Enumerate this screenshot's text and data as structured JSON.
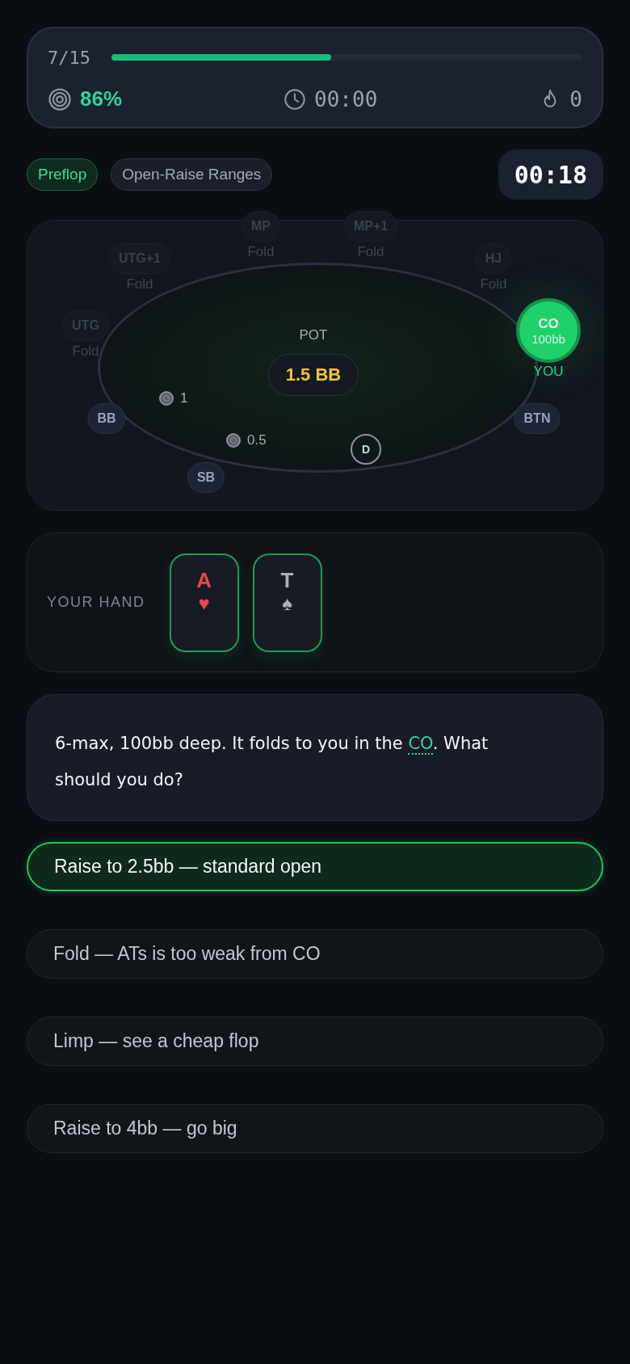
{
  "progress": {
    "count": "7/15",
    "level": 0.467
  },
  "stats": {
    "accuracy": "86%",
    "time": "00:00",
    "streak": "0"
  },
  "tags": [
    {
      "label": "Preflop",
      "kind": "street"
    },
    {
      "label": "Open-Raise Ranges",
      "kind": "topic"
    }
  ],
  "timer": "00:18",
  "table": {
    "seats": [
      {
        "position": "MP",
        "action": "Fold",
        "kind": "folded"
      },
      {
        "position": "MP+1",
        "action": "Fold",
        "kind": "folded"
      },
      {
        "position": "UTG+1",
        "action": "Fold",
        "kind": "folded"
      },
      {
        "position": "HJ",
        "action": "Fold",
        "kind": "folded"
      },
      {
        "position": "UTG",
        "action": "Fold",
        "kind": "folded"
      },
      {
        "position": "CO",
        "stack": "100bb",
        "tag": "YOU",
        "kind": "hero"
      },
      {
        "position": "BB",
        "kind": "waiting"
      },
      {
        "position": "BTN",
        "kind": "waiting"
      },
      {
        "position": "SB",
        "kind": "waiting"
      }
    ],
    "pot_label": "POT",
    "pot": "1.5 BB",
    "bets": [
      {
        "amount": "1"
      },
      {
        "amount": "0.5"
      }
    ],
    "dealer": "D"
  },
  "hand": {
    "label": "YOUR HAND",
    "cards": [
      {
        "rank": "A",
        "suit": "♥",
        "color": "#e5484d"
      },
      {
        "rank": "T",
        "suit": "♠",
        "color": "#a9b0bc"
      }
    ]
  },
  "question": {
    "before": "6-max, 100bb deep. It folds to you in the ",
    "term": "CO",
    "after": ". What should you do?"
  },
  "options": [
    {
      "label": "Raise to 2.5bb — standard open",
      "selected": true
    },
    {
      "label": "Fold — ATs is too weak from CO",
      "selected": false
    },
    {
      "label": "Limp — see a cheap flop",
      "selected": false
    },
    {
      "label": "Raise to 4bb — go big",
      "selected": false
    }
  ]
}
